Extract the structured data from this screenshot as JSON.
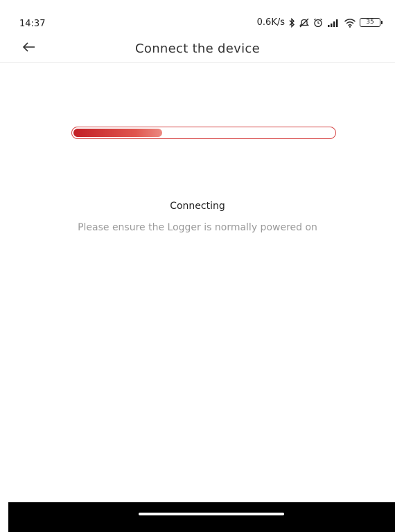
{
  "status_bar": {
    "time": "14:37",
    "network_speed": "0.6K/s",
    "battery_level": "35",
    "icons": [
      "bluetooth-icon",
      "mute-icon",
      "alarm-icon",
      "cellular-signal-icon",
      "wifi-icon",
      "battery-icon"
    ]
  },
  "header": {
    "back_icon": "arrow-left-icon",
    "title": "Connect the device"
  },
  "progress": {
    "percent": 34,
    "accent_color": "#d64545"
  },
  "connection": {
    "status": "Connecting",
    "hint": "Please ensure the Logger is normally powered on"
  }
}
